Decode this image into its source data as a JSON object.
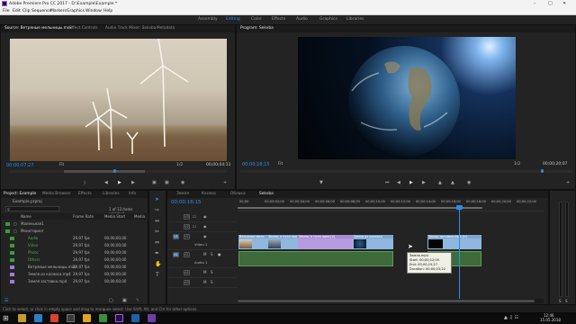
{
  "window": {
    "title": "Adobe Premiere Pro CC 2017 - D:\\Example\\Example *"
  },
  "menu": [
    "File",
    "Edit",
    "Clip",
    "Sequence",
    "Markers",
    "Graphics",
    "Window",
    "Help"
  ],
  "workspaces": [
    "Assembly",
    "Editing",
    "Color",
    "Effects",
    "Audio",
    "Graphics",
    "Libraries"
  ],
  "source": {
    "tabs": [
      "Source: Ветряные мельницы.mov",
      "Effect Controls",
      "Audio Track Mixer: Sekvba",
      "Metadata"
    ],
    "timecode_in": "00;00;07;27",
    "timecode_out": "00;00;04;11",
    "fit": "Fit",
    "page": "1/2"
  },
  "program": {
    "tab": "Program: Sekvba",
    "timecode_in": "00;00;18;15",
    "timecode_out": "00;00;20;07",
    "fit": "Fit",
    "page": "1/2"
  },
  "project": {
    "tabs": [
      "Project: Example",
      "Media Browser",
      "Effects",
      "Libraries",
      "Info"
    ],
    "name": "Example.prproj",
    "count": "1 of 13 items selected",
    "columns": [
      "Name",
      "Frame Rate",
      "Media Start",
      "Media"
    ],
    "items": [
      {
        "name": "Маленькая1",
        "rate": "",
        "start": ""
      },
      {
        "name": "Мониторинг",
        "rate": "",
        "start": ""
      },
      {
        "name": "Audio",
        "rate": "29,97 fps",
        "start": "00;00;00;00"
      },
      {
        "name": "Video",
        "rate": "29,97 fps",
        "start": "00;00;00;00"
      },
      {
        "name": "Photo",
        "rate": "29,97 fps",
        "start": "00;00;00;00"
      },
      {
        "name": "Others",
        "rate": "29,97 fps",
        "start": "00;00;00;00"
      },
      {
        "name": "Ветряные мельницы.mov",
        "rate": "29,97 fps",
        "start": "00;00;00;00"
      },
      {
        "name": "Земля из космоса.mp4",
        "rate": "29,97 fps",
        "start": "00;00;00;00"
      },
      {
        "name": "Земля заставка.mp4",
        "rate": "29,97 fps",
        "start": "00;00;00;00"
      }
    ]
  },
  "timeline": {
    "tabs": [
      "Земля",
      "Космос",
      "Облака",
      "Sekvba"
    ],
    "timecode": "00;00;18;15",
    "ruler": [
      "00;00",
      "00;00;02;00",
      "00;00;04;00",
      "00;00;06;00",
      "00;00;08;00",
      "00;00;10;00",
      "00;00;12;00",
      "00;00;14;00",
      "00;00;16;00",
      "00;00;18;00",
      "00;00;20;00",
      "00;00;22;00"
    ],
    "tracks": [
      "V3",
      "V2",
      "V1",
      "A1",
      "A2",
      "A3"
    ],
    "track_labels": {
      "v1": "Video 1",
      "a1": "Audio 1"
    },
    "clips": [
      {
        "label": "Ветряные мель"
      },
      {
        "label": "Земля, в пути поле"
      },
      {
        "label": "Земля, в пути поле [V]"
      },
      {
        "label": "Земля из космоса"
      },
      {
        "label": "Земля заставка.mp4 [V]"
      }
    ],
    "tooltip": [
      "Земля.mp4",
      "Start: 00;00;12;05",
      "End: 00;00;15;27",
      "Duration: 00;00;03;22"
    ]
  },
  "status": "Click to select, or click in empty space and drag to marquee select. Use Shift, Alt, and Ctrl for other options.",
  "clock": {
    "time": "12:46",
    "date": "15.05.2018"
  },
  "colors": {
    "accent": "#2d8ceb",
    "clip_video": "#8fb7e0",
    "clip_purple": "#b79be0",
    "audio_green": "#4a8c3c"
  }
}
